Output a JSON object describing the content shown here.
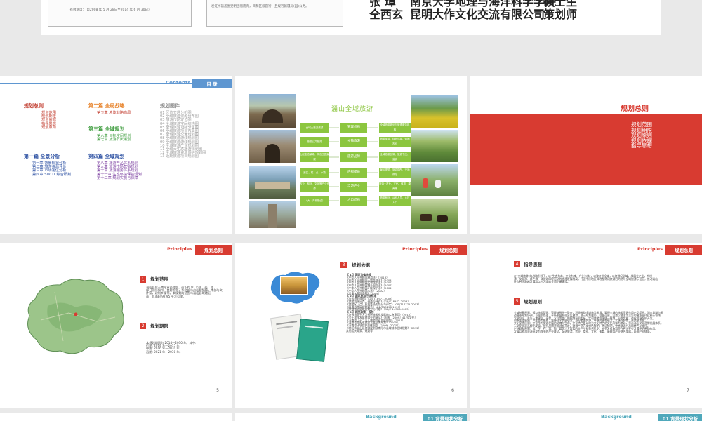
{
  "top_slide": {
    "cert_left_text": "（有效期自：  自2008 年 5 月 28日至2014 年 6 月 30日）",
    "cert_right_text": "发证书前盖图受明函而而有，目和区被圆行，且规行新疆局(园)公务。",
    "rows": [
      {
        "name": "张  璋",
        "org": "南京大学地理与海洋科学学院",
        "role": "硕士生"
      },
      {
        "name": "仝西玄",
        "org": "昆明大作文化交流有限公司",
        "role": "策划师"
      }
    ]
  },
  "toc": {
    "header_en": "Contents",
    "header_cn": "目  录",
    "col1": {
      "title": "规划总则",
      "items": [
        "规划范围",
        "规划期限",
        "规划依据",
        "指导思想",
        "规划原则"
      ],
      "part1_title": "第一篇 全景分析",
      "part1_items": [
        "第一章 背景现状分析",
        "第二章 旅游资源评价",
        "第三章 市场定位分析",
        "第四章 SWOT 综合研判"
      ]
    },
    "col2": {
      "part2_title": "第二篇 全局战略",
      "part2_items": [
        "第五章 总体战略布局"
      ],
      "part3_title": "第三篇 全域规划",
      "part3_items": [
        "第六章 目标空间规划",
        "第七章 旅游节庆策划"
      ],
      "part4_title": "第四篇 全域规划",
      "part4_items": [
        "第八章 旅游产品体系规划",
        "第九章 旅游市场营销规划",
        "第十章 旅游服务体系规划",
        "第十一章 生态环境保护规划",
        "第十二章 规划实施与保障"
      ]
    },
    "col3": {
      "title": "规划图件",
      "items": [
        "01 区位交通分析图",
        "02 全域旅游资源分布图",
        "03 旅游市场定位图",
        "04 全域旅游空间结构图",
        "05 全域旅游功能分区图",
        "06 全域旅游项目布局图",
        "07 全域旅游交通规划图",
        "08 全域旅游游线规划图",
        "09 全域旅游游线规划图",
        "10 全域旅游产业规划图",
        "11 全域大生态旅游规划图",
        "12 全域旅游资源保护规划图",
        "13 近期旅游项目规划图"
      ]
    }
  },
  "diagram": {
    "title": "淄山全域旅游",
    "left_boxes": [
      "全域大旅游资源",
      "旅游公共服务",
      "山区生态景观、特色田园景观",
      "景区、村、点、小镇",
      "农业、林业、文化等产业资源",
      "14大（产城融合）"
    ],
    "mid_boxes": [
      "管理机构",
      "乡镇旅游",
      "旅游品牌",
      "内部提质",
      "泛游产业",
      "人口结构"
    ],
    "right_boxes": [
      "全域旅游规划与管理服务机构",
      "旅游乡镇、特色小镇、休闲农业",
      "全域旅游品牌、旅游节庆、营销",
      "景区提质、旅游厕所、交通驿站",
      "旅游+农业、文化、体育、康养等",
      "旅游就业、从业人员、乡村人口"
    ]
  },
  "section_slide": {
    "title": "规划总则",
    "items": [
      "规划范围",
      "规划期限",
      "规划原则",
      "规划依据",
      "指导思想"
    ]
  },
  "slide5": {
    "header_en": "Principles",
    "header_cn": "规划总则",
    "sec1_num": "1",
    "sec1_title": "规划范围",
    "sec1_body": [
      "淄山县位于南阳市西北部，面积约 91 公里，西、北",
      "部分别与如州、登封相邻，东北部与舟山城镇壤，南部与文",
      "件接，建制乡镇带。本规划的范围与淄山县域辖区",
      "面，总面积 92.95 平方公里。"
    ],
    "sec2_num": "2",
    "sec2_title": "规划期限",
    "sec2_body": [
      "本规划期限为 2014—2030 年。其中:",
      "近期:   2014 年—2015 年;",
      "中期:   2016 年—2020 年;",
      "远期:   2021 年—2030 年。"
    ],
    "page": "5"
  },
  "slide6": {
    "header_en": "Principles",
    "header_cn": "规划总则",
    "sec_num": "3",
    "sec_title": "规划依据",
    "lines": [
      "【 1 】国家法律法规",
      "《中华人民共和国旅游法》（2013）",
      "《中华人民共和国土地管理法》（2004）",
      "《中华人民共和国文物保护法》（2007）",
      "《中华人民共和国城乡规划法》（2007）",
      "《中华人民共和国环境保护法》（2002）",
      "《中华人民共和国水法》（2002）",
      "《风景名胜区条例》（2006）",
      "【 2 】国家旅游行业标准",
      "《旅游规划通则》（GB/T18971-2003）",
      "《旅游资源分类、调查与评价》（GB/T18972-2003）",
      "《旅游区（点）质量等级的划分与评定》（GB/T17775-2003）",
      "《风景名胜区规划规范》（GB/T50298-1999）",
      "《旅游饭店星级的划分与评定》（GB/T 14308-2003）",
      "【 3 】相关政策、规划",
      "《许昌市关于大力推进旅游业发展的实施意见》（2012）",
      "《关于加快发展旅游业的意见》（国发〔2009〕41 号文件）",
      "《河南省『十二五』旅游产业发展规划》（2011）",
      "《河南省南阳市旅游发展总体规划》（2005）",
      "《河南省环境保护总体规划（2009—2025）》",
      "《南阳市淄山县旅游规划及南阳市县域城市总体规划》（2012）",
      "其他相关政策、规划等"
    ],
    "page": "6"
  },
  "slide7": {
    "header_en": "Principles",
    "header_cn": "规划总则",
    "sec4_num": "4",
    "sec4_title": "指导思想",
    "sec4_body": [
      "在\"全域旅游\"的战略引领下，以\"生态为本、文化为魂、产业为体\"，以整合带全域，以旅游促全域，发展全产业，乡村",
      "游、文化游、养生游、体验游四轮驱动的旅游发展格局，打造中原地区体验型休闲旅游目的地与全域旅游示范区，推动淄山",
      "社会经济跨越发展和以人为本的全面小康建设。"
    ],
    "sec5_num": "5",
    "sec5_title": "规划原则",
    "sec5_body": [
      "全域统筹原则：遵以旅游管理、管理体系统一整合，积极推动全域旅游发展，要把全域的旅游资源作用产品提升，淄山县域与周",
      "边城市规划协调、与规划管理、平衡发展城市全区旅游。统一规划格局，联合运营。注重以旅游为主导的城市现代化核心领域",
      "发展导向，并与土地建立，环保，水利等部门的规划有机衔接，实现旅游资源统一规划、分期实施，强化资源保护开发。",
      "",
      "创新生态原则：以生态为基底，坚持科学发展理念，充分考虑资源，环境的承载能力，实施保护性，高质量发展。",
      "",
      "文化品牌原则：文化作为旅游发展的灵魂与生命，文化特色是以地方文化特色的文化形象为基础，打造淄山文化品牌发展体系。",
      "入文化资源品牌化发展，依托品牌资源创新开发，旅游产品开发特色鲜明、特征鲜明，完善旅游产品的特色化定位。",
      "",
      "产业联动原则：食、住、行、游、购、娱等六大要素的全产业链整合优化，充分发挥旅游业在经济社会发展中的带动作用。",
      "发展以旅游资源开发为龙头的产业联动，促进旅游、农业、商业、文化、体育、康养等产业融合发展，延伸产业链条。"
    ],
    "page": "7"
  },
  "bottom_row": [
    {
      "header_en": "Background",
      "header_cn": "01 背景现状分析"
    },
    {
      "header_en": "Background",
      "header_cn": "01 背景现状分析"
    }
  ],
  "colors": {
    "accent_blue": "#5f97d1",
    "accent_red": "#d83b31",
    "toc_red": "#c0392b",
    "toc_green": "#3d9c3d",
    "toc_blue": "#2e52a3",
    "teal": "#4fa8bb",
    "diagram_green": "#8cc63f"
  }
}
